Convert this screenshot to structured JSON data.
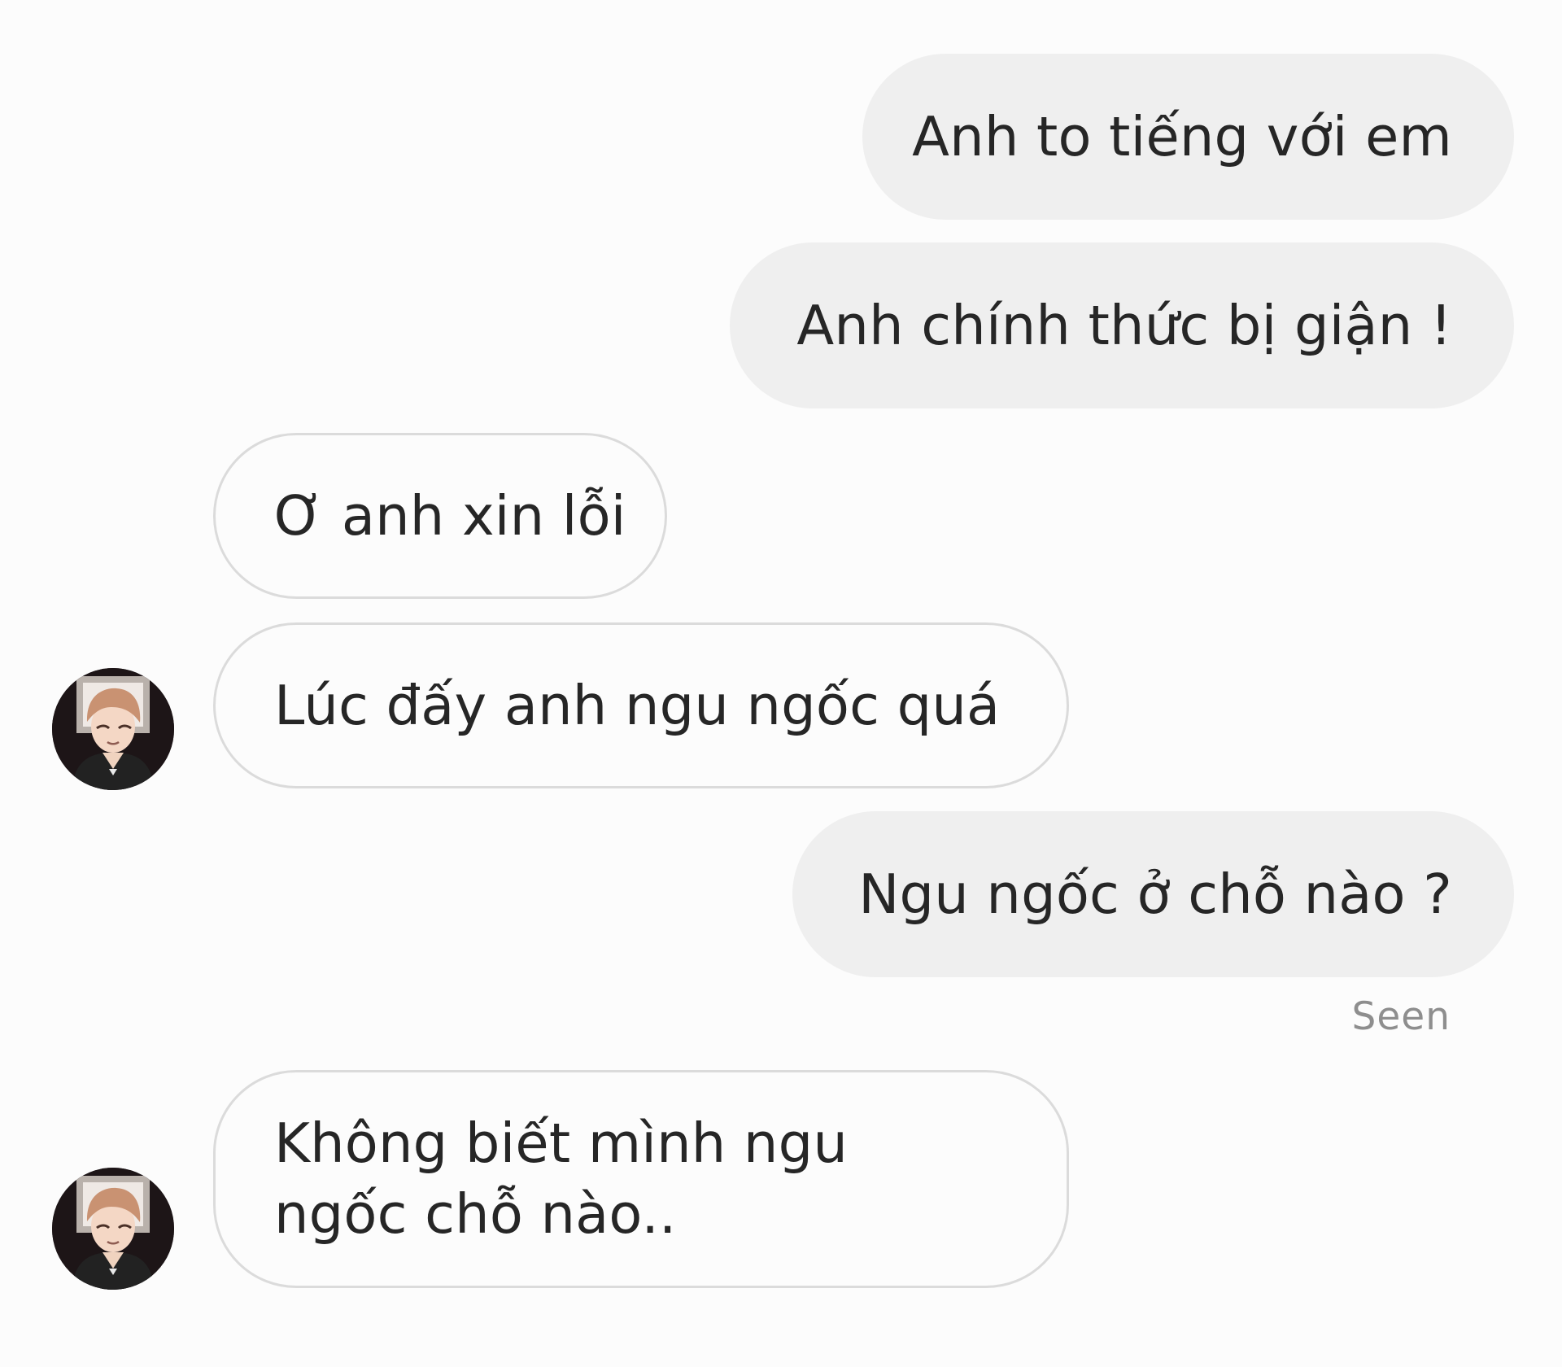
{
  "conversation": {
    "messages": [
      {
        "sender": "me",
        "text": "Anh to tiếng với em"
      },
      {
        "sender": "me",
        "text": "Anh chính thức bị giận !"
      },
      {
        "sender": "other",
        "text": "Ơ anh xin lỗi"
      },
      {
        "sender": "other",
        "text": "Lúc đấy anh ngu ngốc quá"
      },
      {
        "sender": "me",
        "text": "Ngu ngốc ở chỗ nào ?"
      },
      {
        "sender": "other",
        "text": "Không biết mình ngu ngốc chỗ nào.."
      }
    ],
    "seen_label": "Seen"
  },
  "colors": {
    "background": "#fcfcfc",
    "sent_bubble": "#efefef",
    "received_border": "#dbdbdb",
    "text": "#262626",
    "seen_text": "#8e8e8e"
  },
  "icons": {
    "avatar": "contact-avatar-icon"
  }
}
